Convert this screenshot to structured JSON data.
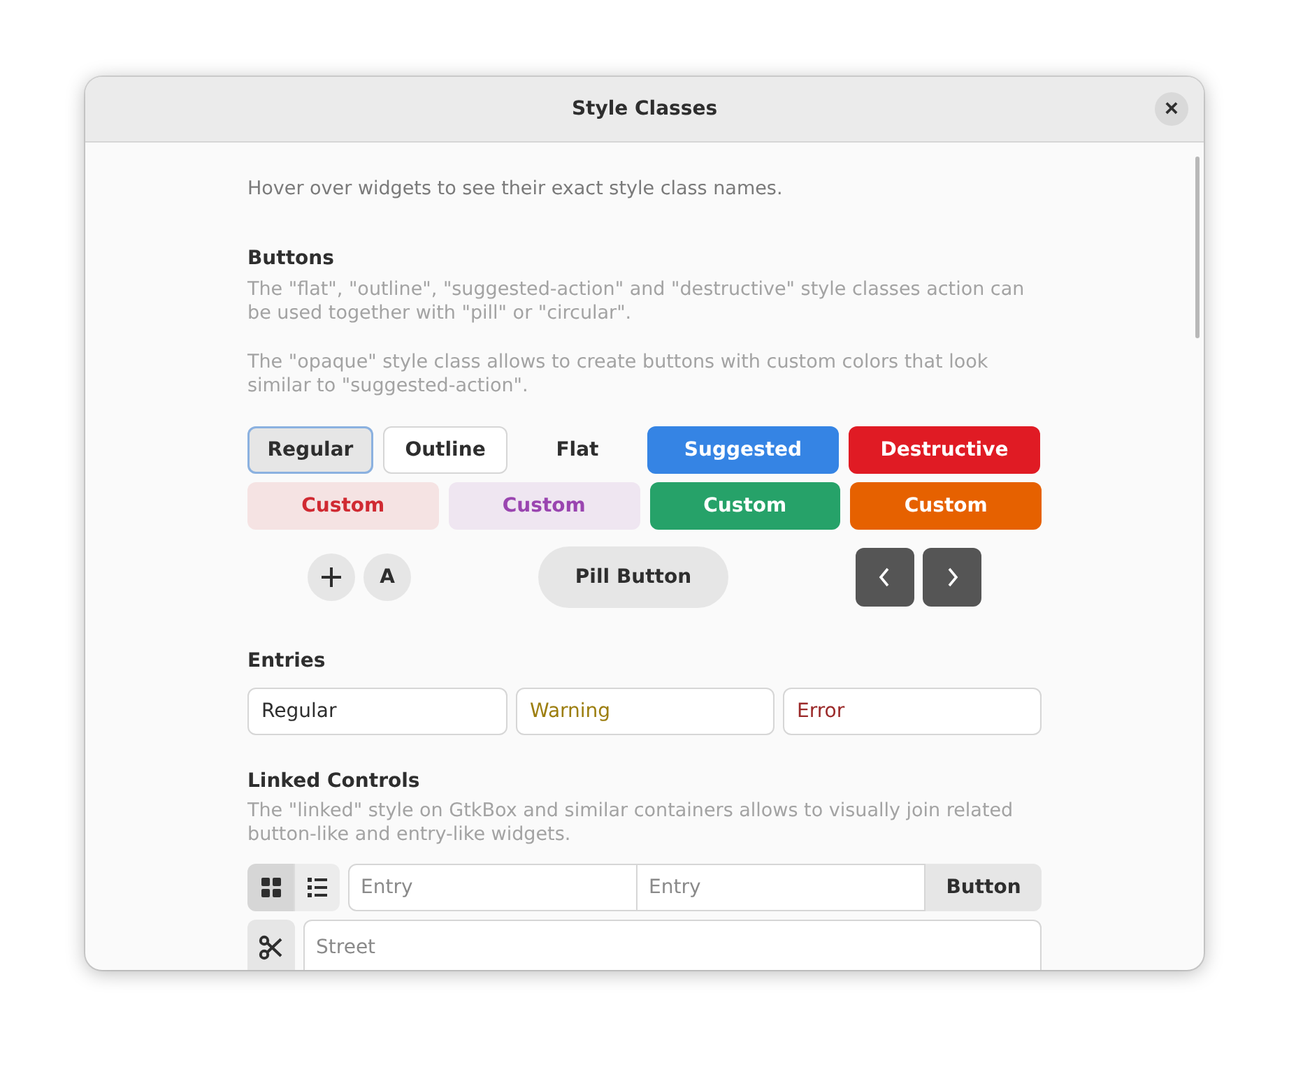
{
  "window": {
    "title": "Style Classes",
    "close": "×"
  },
  "intro": "Hover over widgets to see their exact style class names.",
  "buttons_section": {
    "heading": "Buttons",
    "paragraphs": [
      "The \"flat\", \"outline\", \"suggested-action\" and \"destructive\" style classes action can be used together with \"pill\" or \"circular\".",
      "The \"opaque\" style class allows to create buttons with custom colors that look similar to \"suggested-action\"."
    ],
    "row1": [
      {
        "label": "Regular",
        "kind": "regular"
      },
      {
        "label": "Outline",
        "kind": "outline"
      },
      {
        "label": "Flat",
        "kind": "flat"
      },
      {
        "label": "Suggested",
        "kind": "suggested"
      },
      {
        "label": "Destructive",
        "kind": "destructive"
      }
    ],
    "row2": [
      {
        "label": "Custom",
        "kind": "tinted",
        "color": "#d02a32"
      },
      {
        "label": "Custom",
        "kind": "tinted",
        "color": "#9a45b0"
      },
      {
        "label": "Custom",
        "kind": "opaque",
        "color": "#26a269"
      },
      {
        "label": "Custom",
        "kind": "opaque",
        "color": "#e66100"
      }
    ],
    "circular": [
      "A"
    ],
    "pill": "Pill Button"
  },
  "entries_section": {
    "heading": "Entries",
    "entries": [
      {
        "value": "Regular",
        "kind": "regular"
      },
      {
        "value": "Warning",
        "kind": "warning"
      },
      {
        "value": "Error",
        "kind": "error"
      }
    ]
  },
  "linked_section": {
    "heading": "Linked Controls",
    "paragraph": "The \"linked\" style on GtkBox and similar containers allows to visually join related button-like and entry-like widgets.",
    "toggles": [
      {
        "kind": "grid",
        "selected": true
      },
      {
        "kind": "list",
        "selected": false
      }
    ],
    "entries": [
      {
        "placeholder": "Entry"
      },
      {
        "placeholder": "Entry"
      }
    ],
    "button": "Button",
    "street": {
      "placeholder": "Street"
    }
  }
}
